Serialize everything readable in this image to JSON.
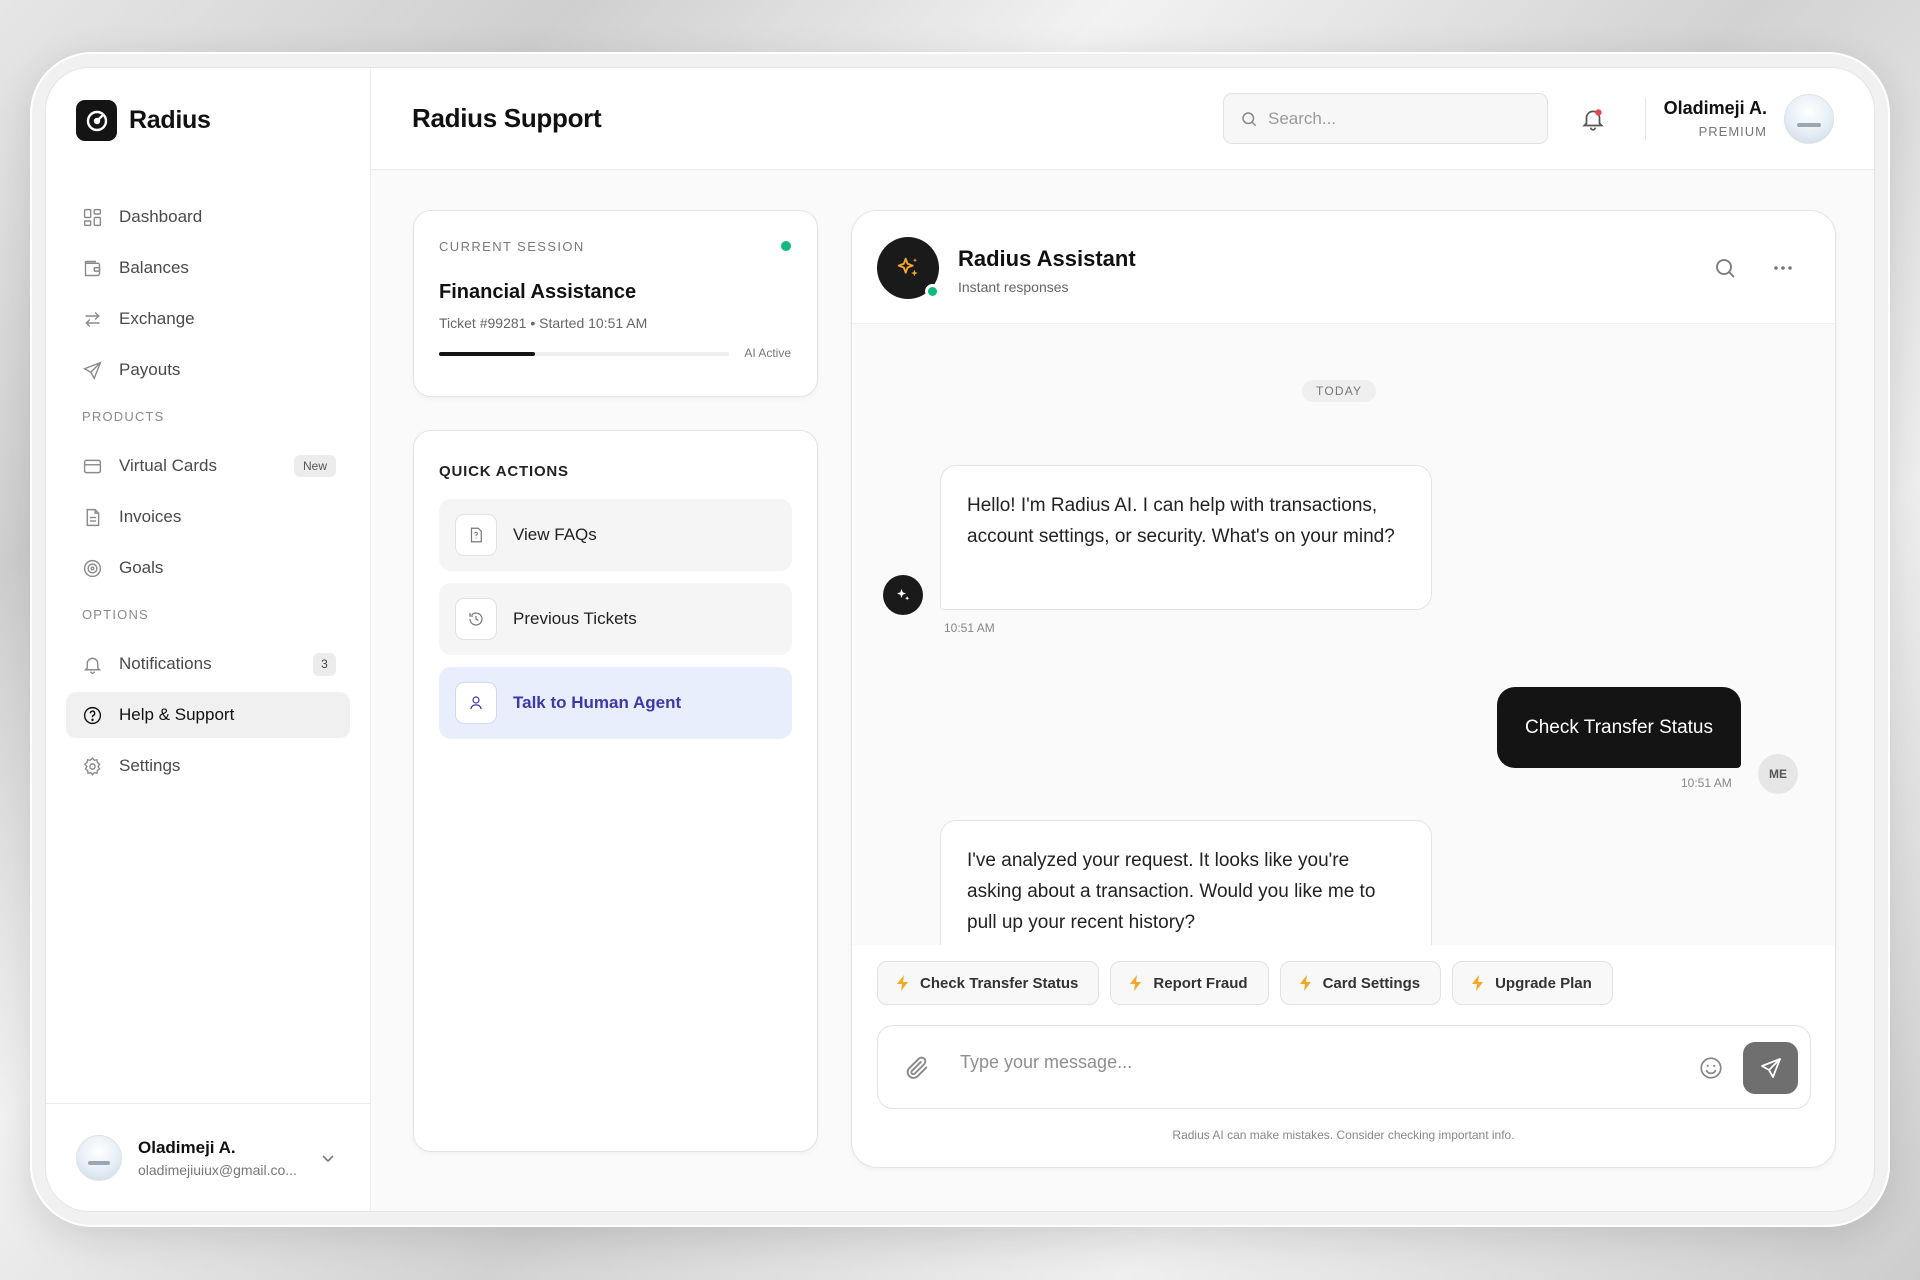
{
  "brand": {
    "name": "Radius"
  },
  "sidebar": {
    "main_items": [
      {
        "label": "Dashboard",
        "icon": "grid-icon"
      },
      {
        "label": "Balances",
        "icon": "wallet-icon"
      },
      {
        "label": "Exchange",
        "icon": "arrows-exchange-icon"
      },
      {
        "label": "Payouts",
        "icon": "send-icon"
      }
    ],
    "products_heading": "PRODUCTS",
    "product_items": [
      {
        "label": "Virtual Cards",
        "icon": "card-icon",
        "badge": "New"
      },
      {
        "label": "Invoices",
        "icon": "document-icon"
      },
      {
        "label": "Goals",
        "icon": "target-icon"
      }
    ],
    "options_heading": "OPTIONS",
    "option_items": [
      {
        "label": "Notifications",
        "icon": "bell-icon",
        "badge": "3"
      },
      {
        "label": "Help & Support",
        "icon": "help-circle-icon",
        "active": true
      },
      {
        "label": "Settings",
        "icon": "gear-icon"
      }
    ],
    "user": {
      "name": "Oladimeji A.",
      "email": "oladimejiuiux@gmail.co..."
    }
  },
  "header": {
    "title": "Radius Support",
    "search_placeholder": "Search...",
    "user_name": "Oladimeji A.",
    "user_tier": "PREMIUM"
  },
  "session": {
    "label": "CURRENT SESSION",
    "title": "Financial Assistance",
    "meta": "Ticket #99281 • Started 10:51 AM",
    "status": "AI Active",
    "progress": 0.33
  },
  "quick_actions": {
    "title": "QUICK ACTIONS",
    "items": [
      {
        "label": "View FAQs",
        "icon": "faq-icon"
      },
      {
        "label": "Previous Tickets",
        "icon": "history-icon"
      },
      {
        "label": "Talk to Human Agent",
        "icon": "user-icon"
      }
    ]
  },
  "chat": {
    "assistant_name": "Radius Assistant",
    "assistant_sub": "Instant responses",
    "date_divider": "TODAY",
    "messages": [
      {
        "from": "bot",
        "text": "Hello! I'm Radius AI. I can help with transactions, account settings, or security. What's on your mind?",
        "time": "10:51 AM"
      },
      {
        "from": "me",
        "text": "Check Transfer Status",
        "time": "10:51 AM",
        "avatar": "ME"
      },
      {
        "from": "bot",
        "text": "I've analyzed your request. It looks like you're asking about a transaction. Would you like me to pull up your recent history?"
      }
    ],
    "suggestions": [
      "Check Transfer Status",
      "Report Fraud",
      "Card Settings",
      "Upgrade Plan"
    ],
    "input_placeholder": "Type your message...",
    "disclaimer": "Radius AI can make mistakes. Consider checking important info."
  },
  "colors": {
    "accent_dark": "#141414",
    "online": "#10b981",
    "primary_action_bg": "#e9eefc",
    "primary_action_text": "#3b3aa8",
    "chip_bolt": "#f5a623"
  }
}
